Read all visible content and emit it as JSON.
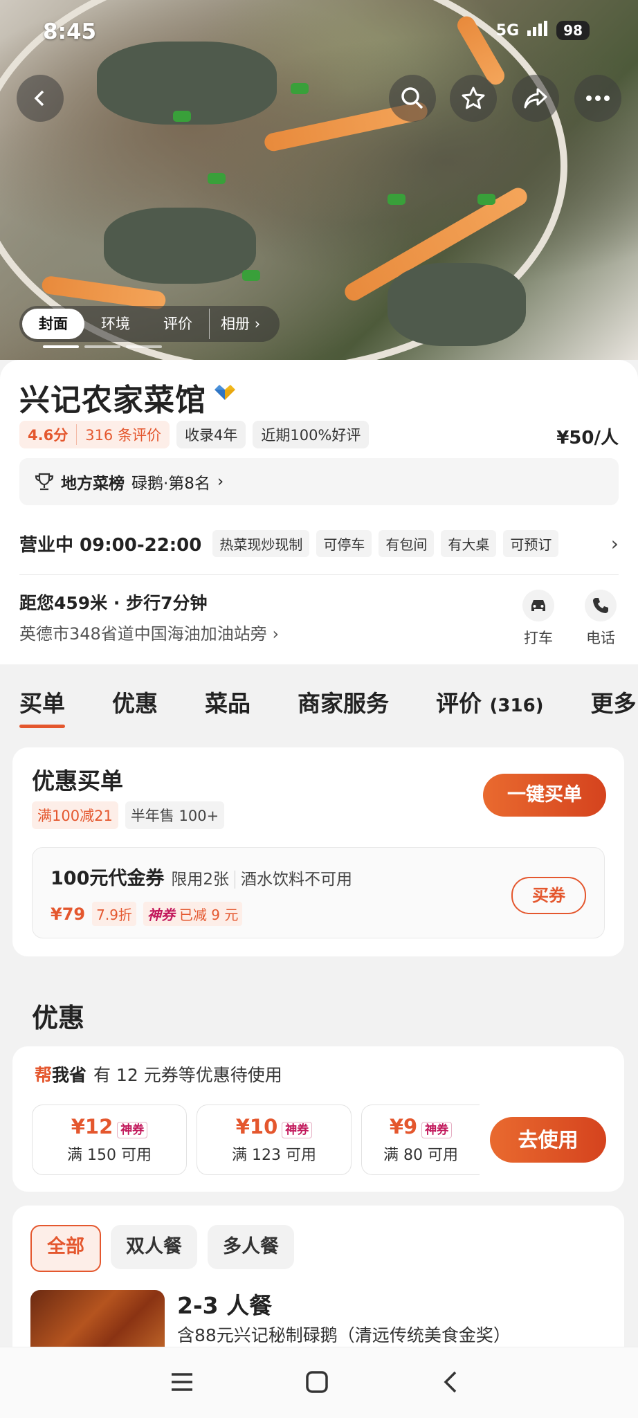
{
  "status_bar": {
    "time": "8:45",
    "network": "5G",
    "battery": "98"
  },
  "hero": {
    "tabs": [
      "封面",
      "环境",
      "评价",
      "相册"
    ]
  },
  "shop": {
    "name": "兴记农家菜馆",
    "score": "4.6分",
    "reviews": "316 条评价",
    "listed": "收录4年",
    "good_rate": "近期100%好评",
    "price": "¥50/人",
    "ranking": {
      "label": "地方菜榜",
      "detail": "碌鹅·第8名"
    },
    "hours_label": "营业中 09:00-22:00",
    "features": [
      "热菜现炒现制",
      "可停车",
      "有包间",
      "有大桌",
      "可预订"
    ],
    "distance": "距您459米 · 步行7分钟",
    "address": "英德市348省道中国海油加油站旁",
    "actions": {
      "taxi": "打车",
      "phone": "电话"
    }
  },
  "tabs": {
    "t1": "买单",
    "t2": "优惠",
    "t3": "菜品",
    "t4": "商家服务",
    "t5": "评价",
    "t5_count": "(316)",
    "t6": "更多"
  },
  "pay": {
    "title": "优惠买单",
    "tag_discount": "满100减21",
    "tag_sales": "半年售 100+",
    "button": "一键买单",
    "voucher": {
      "title": "100元代金券",
      "limit": "限用2张",
      "restriction": "酒水饮料不可用",
      "price": "¥79",
      "discount": "7.9折",
      "god_label": "神券",
      "saved": "已减 9 元",
      "button": "买券"
    }
  },
  "offers": {
    "section_title": "优惠",
    "help_bang": "帮",
    "help_label": "我省",
    "help_desc": "有 12 元券等优惠待使用",
    "coupons": [
      {
        "amount": "¥12",
        "tag": "神券",
        "cond": "满 150 可用"
      },
      {
        "amount": "¥10",
        "tag": "神券",
        "cond": "满 123 可用"
      },
      {
        "amount": "¥9",
        "tag": "神券",
        "cond": "满 80 可用"
      }
    ],
    "button": "去使用"
  },
  "meals": {
    "filters": [
      "全部",
      "双人餐",
      "多人餐"
    ],
    "item_title": "2-3 人餐",
    "item_desc": "含88元兴记秘制碌鹅（清远传统美食金奖）"
  },
  "colors": {
    "accent": "#e4572e",
    "god_coupon": "#c2185b"
  }
}
